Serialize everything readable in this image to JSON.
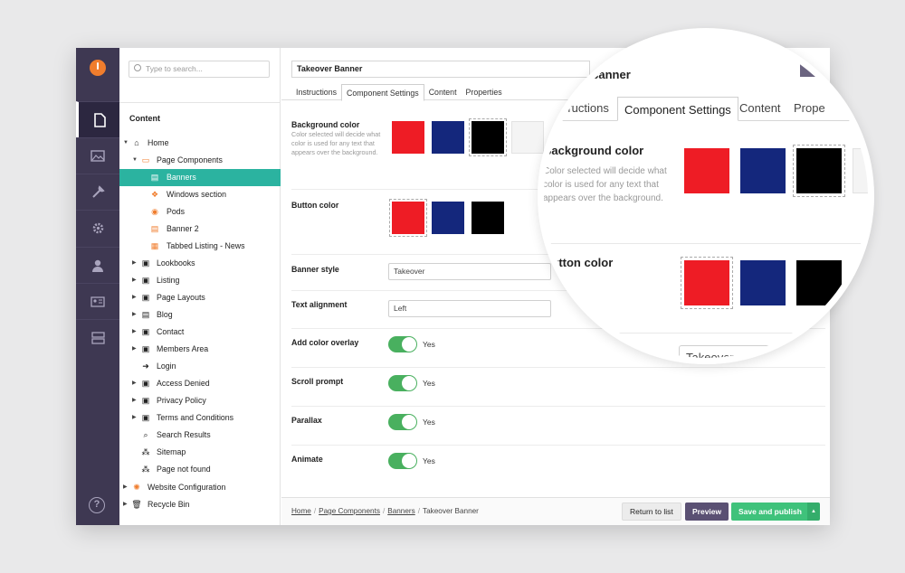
{
  "rail": {
    "icons": [
      "logo-icon",
      "page-icon",
      "image-icon",
      "wrench-icon",
      "gear-icon",
      "user-icon",
      "contact-card-icon",
      "layout-icon",
      "help-icon"
    ]
  },
  "tree": {
    "search_placeholder": "Type to search...",
    "heading": "Content",
    "items": [
      {
        "label": "Home",
        "icon": "home-icon"
      },
      {
        "label": "Page Components",
        "icon": "folder-icon"
      },
      {
        "label": "Banners",
        "icon": "banner-icon",
        "selected": true
      },
      {
        "label": "Windows section",
        "icon": "component-icon"
      },
      {
        "label": "Pods",
        "icon": "pod-icon"
      },
      {
        "label": "Banner 2",
        "icon": "banner-icon"
      },
      {
        "label": "Tabbed Listing - News",
        "icon": "tabbed-icon"
      },
      {
        "label": "Lookbooks",
        "icon": "page-icon"
      },
      {
        "label": "Listing",
        "icon": "page-icon"
      },
      {
        "label": "Page Layouts",
        "icon": "page-icon"
      },
      {
        "label": "Blog",
        "icon": "blog-icon"
      },
      {
        "label": "Contact",
        "icon": "page-icon"
      },
      {
        "label": "Members Area",
        "icon": "page-icon"
      },
      {
        "label": "Login",
        "icon": "arrow-right-icon"
      },
      {
        "label": "Access Denied",
        "icon": "page-icon"
      },
      {
        "label": "Privacy Policy",
        "icon": "page-icon"
      },
      {
        "label": "Terms and Conditions",
        "icon": "page-icon"
      },
      {
        "label": "Search Results",
        "icon": "search-icon"
      },
      {
        "label": "Sitemap",
        "icon": "sitemap-icon"
      },
      {
        "label": "Page not found",
        "icon": "sitemap-icon"
      },
      {
        "label": "Website Configuration",
        "icon": "gear-icon"
      },
      {
        "label": "Recycle Bin",
        "icon": "trash-icon"
      }
    ]
  },
  "main": {
    "title": "Takeover Banner",
    "tabs": [
      "Instructions",
      "Component Settings",
      "Content",
      "Properties"
    ],
    "active_tab": "Component Settings",
    "background_color": {
      "label": "Background color",
      "description": "Color selected will decide what color is used for any text that appears over the background.",
      "swatches": [
        "#ee1c25",
        "#14277c",
        "#000000",
        "#f4f4f4"
      ],
      "selected": "#000000"
    },
    "button_color": {
      "label": "Button color",
      "swatches": [
        "#ee1c25",
        "#14277c",
        "#000000"
      ],
      "selected": "#ee1c25"
    },
    "banner_style": {
      "label": "Banner style",
      "value": "Takeover"
    },
    "text_alignment": {
      "label": "Text alignment",
      "value": "Left"
    },
    "add_color_overlay": {
      "label": "Add color overlay",
      "value": "Yes"
    },
    "scroll_prompt": {
      "label": "Scroll prompt",
      "value": "Yes"
    },
    "parallax": {
      "label": "Parallax",
      "value": "Yes"
    },
    "animate": {
      "label": "Animate",
      "value": "Yes"
    }
  },
  "footer": {
    "breadcrumb": [
      "Home",
      "Page Components",
      "Banners",
      "Takeover Banner"
    ],
    "return_label": "Return to list",
    "preview_label": "Preview",
    "publish_label": "Save and publish"
  },
  "magnifier": {
    "title_fragment": "Banner",
    "tabs": [
      "nstructions",
      "Component Settings",
      "Content",
      "Prope"
    ],
    "bg_label": "Background color",
    "bg_description": "Color selected will decide what color is used for any text that appears over the background.",
    "button_label": "Button color",
    "select_value": "Takeover"
  },
  "colors": {
    "rail": "#3e3852",
    "selected": "#2bb3a0",
    "toggle": "#49b05f",
    "preview": "#5a5073",
    "publish": "#3fc27b"
  }
}
